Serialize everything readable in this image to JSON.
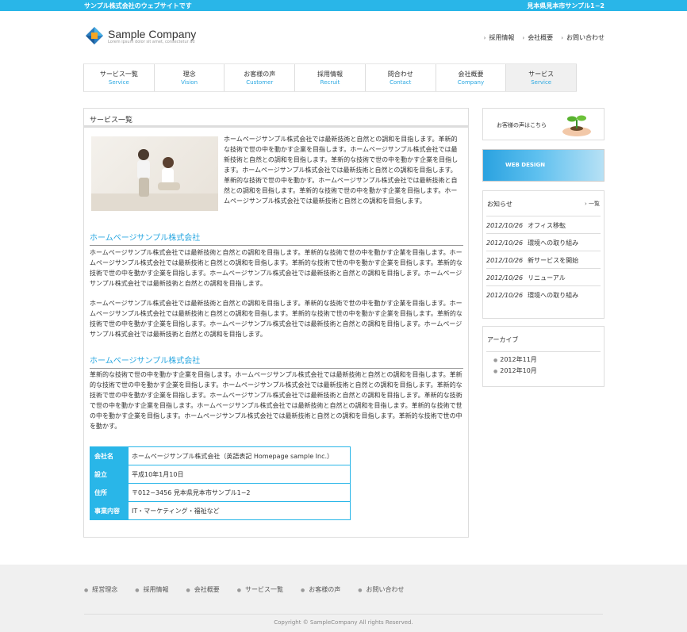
{
  "topbar": {
    "left": "サンプル株式会社のウェブサイトです",
    "right": "見本県見本市サンプル1−2"
  },
  "logo": {
    "name": "Sample Company",
    "sub": "Lorem ipsum dolor sit amet, consectetur ad"
  },
  "header_links": [
    {
      "mark": "›",
      "label": "採用情報"
    },
    {
      "mark": "›",
      "label": "会社概要"
    },
    {
      "mark": "›",
      "label": "お問い合わせ"
    }
  ],
  "gnav": [
    {
      "jp": "サービス一覧",
      "en": "Service"
    },
    {
      "jp": "理念",
      "en": "Vision"
    },
    {
      "jp": "お客様の声",
      "en": "Customer"
    },
    {
      "jp": "採用情報",
      "en": "Recruit"
    },
    {
      "jp": "問合わせ",
      "en": "Contact"
    },
    {
      "jp": "会社概要",
      "en": "Company"
    },
    {
      "jp": "サービス",
      "en": "Service"
    }
  ],
  "main": {
    "title": "サービス一覧",
    "intro": "ホームページサンプル株式会社では最新技術と自然との調和を目指します。革新的な技術で世の中を動かす企業を目指します。ホームページサンプル株式会社では最新技術と自然との調和を目指します。革新的な技術で世の中を動かす企業を目指します。ホームページサンプル株式会社では最新技術と自然との調和を目指します。革新的な技術で世の中を動かす。ホームページサンプル株式会社では最新技術と自然との調和を目指します。革新的な技術で世の中を動かす企業を目指します。ホームページサンプル株式会社では最新技術と自然との調和を目指します。",
    "section1": {
      "heading": "ホームページサンプル株式会社",
      "p1": "ホームページサンプル株式会社では最新技術と自然との調和を目指します。革新的な技術で世の中を動かす企業を目指します。ホームページサンプル株式会社では最新技術と自然との調和を目指します。革新的な技術で世の中を動かす企業を目指します。革新的な技術で世の中を動かす企業を目指します。ホームページサンプル株式会社では最新技術と自然との調和を目指します。ホームページサンプル株式会社では最新技術と自然との調和を目指します。",
      "p2": "ホームページサンプル株式会社では最新技術と自然との調和を目指します。革新的な技術で世の中を動かす企業を目指します。ホームページサンプル株式会社では最新技術と自然との調和を目指します。革新的な技術で世の中を動かす企業を目指します。革新的な技術で世の中を動かす企業を目指します。ホームページサンプル株式会社では最新技術と自然との調和を目指します。ホームページサンプル株式会社では最新技術と自然との調和を目指します。"
    },
    "section2": {
      "heading": "ホームページサンプル株式会社",
      "p1": "革新的な技術で世の中を動かす企業を目指します。ホームページサンプル株式会社では最新技術と自然との調和を目指します。革新的な技術で世の中を動かす企業を目指します。ホームページサンプル株式会社では最新技術と自然との調和を目指します。革新的な技術で世の中を動かす企業を目指します。ホームページサンプル株式会社では最新技術と自然との調和を目指します。革新的な技術で世の中を動かす企業を目指します。ホームページサンプル株式会社では最新技術と自然との調和を目指します。革新的な技術で世の中を動かす企業を目指します。ホームページサンプル株式会社では最新技術と自然との調和を目指します。革新的な技術で世の中を動かす。"
    },
    "info_table": [
      {
        "label": "会社名",
        "value": "ホームページサンプル株式会社（英語表記 Homepage sample Inc.）"
      },
      {
        "label": "設立",
        "value": "平成10年1月10日"
      },
      {
        "label": "住所",
        "value": "〒012−3456 見本県見本市サンプル1−2"
      },
      {
        "label": "事業内容",
        "value": "IT・マーケティング・福祉など"
      }
    ]
  },
  "sidebar": {
    "banner1": "お客様の声はこちら",
    "banner2": "WEB DESIGN",
    "news": {
      "heading": "お知らせ",
      "more": "› 一覧",
      "items": [
        {
          "date": "2012/10/26",
          "title": "オフィス移転"
        },
        {
          "date": "2012/10/26",
          "title": "環境への取り組み"
        },
        {
          "date": "2012/10/26",
          "title": "新サービスを開始"
        },
        {
          "date": "2012/10/26",
          "title": "リニューアル"
        },
        {
          "date": "2012/10/26",
          "title": "環境への取り組み"
        }
      ]
    },
    "archive": {
      "heading": "アーカイブ",
      "items": [
        "2012年11月",
        "2012年10月"
      ]
    }
  },
  "footer": {
    "links": [
      "経営理念",
      "採用情報",
      "会社概要",
      "サービス一覧",
      "お客様の声",
      "お問い合わせ"
    ],
    "copyright": "Copyright © SampleCompany All rights Reserved."
  },
  "colors": {
    "accent": "#29b6e8",
    "link": "#29a7e1",
    "footer_bg": "#f0f0f0"
  }
}
